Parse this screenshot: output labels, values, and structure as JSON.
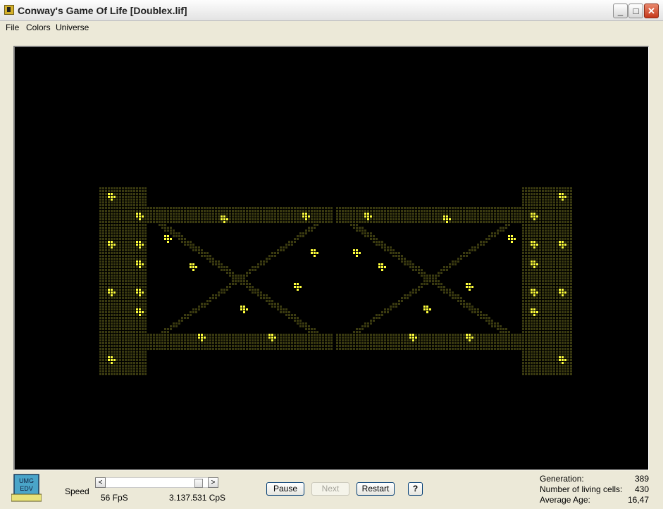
{
  "window": {
    "title": "Conway's Game Of Life [Doublex.lif]",
    "minimize_glyph": "_",
    "maximize_glyph": "□",
    "close_glyph": "✕"
  },
  "menu": {
    "items": [
      "File",
      "Colors",
      "Universe"
    ]
  },
  "universe": {
    "background": "#000000",
    "cell_dead_trail_color": "#3a3a10",
    "cell_live_color": "#ffff3c",
    "cell_size": 4
  },
  "logo": {
    "line1": "UMG",
    "line2": "EDV"
  },
  "controls": {
    "speed_label": "Speed",
    "fps_text": "56 FpS",
    "cps_text": "3.137.531 CpS",
    "speed_position": 0.95,
    "left_arrow": "<",
    "right_arrow": ">",
    "pause_label": "Pause",
    "next_label": "Next",
    "restart_label": "Restart",
    "help_label": "?"
  },
  "stats": {
    "generation_label": "Generation:",
    "generation_value": "389",
    "living_cells_label": "Number of living cells:",
    "living_cells_value": "430",
    "average_age_label": "Average Age:",
    "average_age_value": "16,47"
  }
}
